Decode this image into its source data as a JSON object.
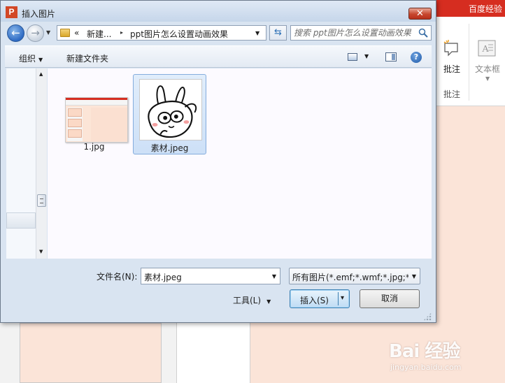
{
  "dialog": {
    "title": "插入图片",
    "close_label": "✕",
    "app_icon_letter": "P"
  },
  "navigation": {
    "back_icon": "back-arrow-icon",
    "forward_icon": "forward-arrow-icon",
    "breadcrumb": {
      "overflow": "«",
      "parent": "新建...",
      "separator": "▸",
      "current": "ppt图片怎么设置动画效果"
    },
    "search_placeholder": "搜索 ppt图片怎么设置动画效果"
  },
  "toolbar": {
    "organize_label": "组织",
    "new_folder_label": "新建文件夹"
  },
  "files": [
    {
      "name": "1.jpg",
      "thumbnail": "powerpoint-screenshot",
      "selected": false
    },
    {
      "name": "素材.jpeg",
      "thumbnail": "rabbit-sticker",
      "selected": true
    }
  ],
  "footer": {
    "filename_label": "文件名(N):",
    "filename_value": "素材.jpeg",
    "filetype_value": "所有图片(*.emf;*.wmf;*.jpg;*.jp",
    "tools_label": "工具(L)",
    "insert_label": "插入(S)",
    "cancel_label": "取消"
  },
  "background_app": {
    "title_fragment": "百度经验",
    "ribbon_comment_label": "批注",
    "ribbon_comment_group": "批注",
    "ribbon_textbox_label": "文本框"
  },
  "watermark": {
    "brand": "Bai 经验",
    "site": "jingyan.baidu.com"
  },
  "colors": {
    "accent_red": "#d62d20",
    "slide_bg": "#fbe4d8",
    "selection_blue": "#cde0f7",
    "dialog_frame": "#d9e4f1"
  }
}
